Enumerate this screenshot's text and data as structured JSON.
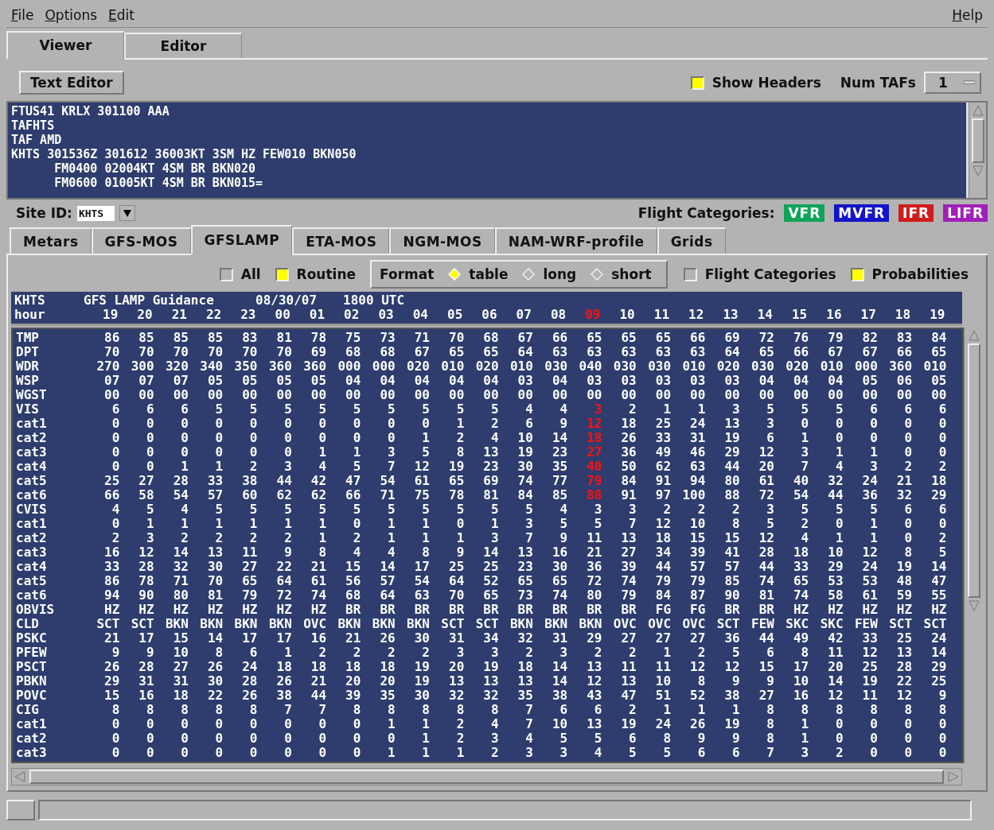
{
  "menu": {
    "left": [
      "File",
      "Options",
      "Edit"
    ],
    "right": [
      "Help"
    ]
  },
  "view_tabs": [
    {
      "label": "Viewer",
      "selected": true
    },
    {
      "label": "Editor",
      "selected": false
    }
  ],
  "toolbar": {
    "text_editor_button": "Text Editor",
    "show_headers": {
      "label": "Show Headers",
      "checked": true
    },
    "num_tafs": {
      "label": "Num TAFs",
      "value": "1"
    }
  },
  "taf_text": [
    "FTUS41 KRLX 301100 AAA",
    "TAFHTS",
    "TAF AMD",
    "KHTS 301536Z 301612 36003KT 3SM HZ FEW010 BKN050",
    "      FM0400 02004KT 4SM BR BKN020",
    "      FM0600 01005KT 4SM BR BKN015="
  ],
  "site": {
    "label": "Site ID:",
    "value": "KHTS"
  },
  "flight_categories": {
    "label": "Flight Categories:",
    "items": [
      {
        "label": "VFR",
        "color": "#0fa45a"
      },
      {
        "label": "MVFR",
        "color": "#1414c8"
      },
      {
        "label": "IFR",
        "color": "#d01c1c"
      },
      {
        "label": "LIFR",
        "color": "#a020b8"
      }
    ]
  },
  "guidance_tabs": [
    {
      "label": "Metars",
      "selected": false
    },
    {
      "label": "GFS-MOS",
      "selected": false
    },
    {
      "label": "GFSLAMP",
      "selected": true
    },
    {
      "label": "ETA-MOS",
      "selected": false
    },
    {
      "label": "NGM-MOS",
      "selected": false
    },
    {
      "label": "NAM-WRF-profile",
      "selected": false
    },
    {
      "label": "Grids",
      "selected": false
    }
  ],
  "options": {
    "all": {
      "label": "All",
      "checked": false
    },
    "routine": {
      "label": "Routine",
      "checked": true
    },
    "format": {
      "label": "Format",
      "choices": [
        {
          "label": "table",
          "selected": true
        },
        {
          "label": "long",
          "selected": false
        },
        {
          "label": "short",
          "selected": false
        }
      ]
    },
    "flight_categories": {
      "label": "Flight Categories",
      "checked": false
    },
    "probabilities": {
      "label": "Probabilities",
      "checked": true
    }
  },
  "table": {
    "header": {
      "station": "KHTS",
      "title": "GFS LAMP Guidance",
      "date": "08/30/07",
      "time": "1800 UTC"
    },
    "hour_label": "hour",
    "hours": [
      {
        "label": "19",
        "highlighted": false
      },
      {
        "label": "20",
        "highlighted": false
      },
      {
        "label": "21",
        "highlighted": false
      },
      {
        "label": "22",
        "highlighted": false
      },
      {
        "label": "23",
        "highlighted": false
      },
      {
        "label": "00",
        "highlighted": false
      },
      {
        "label": "01",
        "highlighted": false
      },
      {
        "label": "02",
        "highlighted": false
      },
      {
        "label": "03",
        "highlighted": false
      },
      {
        "label": "04",
        "highlighted": false
      },
      {
        "label": "05",
        "highlighted": false
      },
      {
        "label": "06",
        "highlighted": false
      },
      {
        "label": "07",
        "highlighted": false
      },
      {
        "label": "08",
        "highlighted": false
      },
      {
        "label": "09",
        "highlighted": true
      },
      {
        "label": "10",
        "highlighted": false
      },
      {
        "label": "11",
        "highlighted": false
      },
      {
        "label": "12",
        "highlighted": false
      },
      {
        "label": "13",
        "highlighted": false
      },
      {
        "label": "14",
        "highlighted": false
      },
      {
        "label": "15",
        "highlighted": false
      },
      {
        "label": "16",
        "highlighted": false
      },
      {
        "label": "17",
        "highlighted": false
      },
      {
        "label": "18",
        "highlighted": false
      },
      {
        "label": "19",
        "highlighted": false
      }
    ],
    "rows": [
      {
        "label": "TMP",
        "highlighted": false,
        "values": [
          "86",
          "85",
          "85",
          "85",
          "83",
          "81",
          "78",
          "75",
          "73",
          "71",
          "70",
          "68",
          "67",
          "66",
          "65",
          "65",
          "65",
          "66",
          "69",
          "72",
          "76",
          "79",
          "82",
          "83",
          "84"
        ]
      },
      {
        "label": "DPT",
        "highlighted": false,
        "values": [
          "70",
          "70",
          "70",
          "70",
          "70",
          "70",
          "69",
          "68",
          "68",
          "67",
          "65",
          "65",
          "64",
          "63",
          "63",
          "63",
          "63",
          "63",
          "64",
          "65",
          "66",
          "67",
          "67",
          "66",
          "65"
        ]
      },
      {
        "label": "WDR",
        "highlighted": false,
        "values": [
          "270",
          "300",
          "320",
          "340",
          "350",
          "360",
          "360",
          "000",
          "000",
          "020",
          "010",
          "020",
          "010",
          "030",
          "040",
          "030",
          "030",
          "010",
          "020",
          "030",
          "020",
          "010",
          "000",
          "360",
          "010"
        ]
      },
      {
        "label": "WSP",
        "highlighted": false,
        "values": [
          "07",
          "07",
          "07",
          "05",
          "05",
          "05",
          "05",
          "04",
          "04",
          "04",
          "04",
          "04",
          "03",
          "04",
          "03",
          "03",
          "03",
          "03",
          "03",
          "04",
          "04",
          "04",
          "05",
          "06",
          "05"
        ]
      },
      {
        "label": "WGST",
        "highlighted": false,
        "values": [
          "00",
          "00",
          "00",
          "00",
          "00",
          "00",
          "00",
          "00",
          "00",
          "00",
          "00",
          "00",
          "00",
          "00",
          "00",
          "00",
          "00",
          "00",
          "00",
          "00",
          "00",
          "00",
          "00",
          "00",
          "00"
        ]
      },
      {
        "label": "VIS",
        "highlighted": true,
        "values": [
          "6",
          "6",
          "6",
          "5",
          "5",
          "5",
          "5",
          "5",
          "5",
          "5",
          "5",
          "5",
          "4",
          "4",
          "3",
          "2",
          "1",
          "1",
          "3",
          "5",
          "5",
          "5",
          "6",
          "6",
          "6"
        ]
      },
      {
        "label": "cat1",
        "highlighted": true,
        "values": [
          "0",
          "0",
          "0",
          "0",
          "0",
          "0",
          "0",
          "0",
          "0",
          "0",
          "1",
          "2",
          "6",
          "9",
          "12",
          "18",
          "25",
          "24",
          "13",
          "3",
          "0",
          "0",
          "0",
          "0",
          "0"
        ]
      },
      {
        "label": "cat2",
        "highlighted": true,
        "values": [
          "0",
          "0",
          "0",
          "0",
          "0",
          "0",
          "0",
          "0",
          "0",
          "1",
          "2",
          "4",
          "10",
          "14",
          "18",
          "26",
          "33",
          "31",
          "19",
          "6",
          "1",
          "0",
          "0",
          "0",
          "0"
        ]
      },
      {
        "label": "cat3",
        "highlighted": true,
        "values": [
          "0",
          "0",
          "0",
          "0",
          "0",
          "0",
          "1",
          "1",
          "3",
          "5",
          "8",
          "13",
          "19",
          "23",
          "27",
          "36",
          "49",
          "46",
          "29",
          "12",
          "3",
          "1",
          "1",
          "0",
          "0"
        ]
      },
      {
        "label": "cat4",
        "highlighted": true,
        "values": [
          "0",
          "0",
          "1",
          "1",
          "2",
          "3",
          "4",
          "5",
          "7",
          "12",
          "19",
          "23",
          "30",
          "35",
          "40",
          "50",
          "62",
          "63",
          "44",
          "20",
          "7",
          "4",
          "3",
          "2",
          "2"
        ]
      },
      {
        "label": "cat5",
        "highlighted": true,
        "values": [
          "25",
          "27",
          "28",
          "33",
          "38",
          "44",
          "42",
          "47",
          "54",
          "61",
          "65",
          "69",
          "74",
          "77",
          "79",
          "84",
          "91",
          "94",
          "80",
          "61",
          "40",
          "32",
          "24",
          "21",
          "18"
        ]
      },
      {
        "label": "cat6",
        "highlighted": true,
        "values": [
          "66",
          "58",
          "54",
          "57",
          "60",
          "62",
          "62",
          "66",
          "71",
          "75",
          "78",
          "81",
          "84",
          "85",
          "88",
          "91",
          "97",
          "100",
          "88",
          "72",
          "54",
          "44",
          "36",
          "32",
          "29"
        ]
      },
      {
        "label": "CVIS",
        "highlighted": false,
        "values": [
          "4",
          "5",
          "4",
          "5",
          "5",
          "5",
          "5",
          "5",
          "5",
          "5",
          "5",
          "5",
          "5",
          "4",
          "3",
          "3",
          "2",
          "2",
          "2",
          "3",
          "5",
          "5",
          "5",
          "6",
          "6"
        ]
      },
      {
        "label": "cat1",
        "highlighted": false,
        "values": [
          "0",
          "1",
          "1",
          "1",
          "1",
          "1",
          "1",
          "0",
          "1",
          "1",
          "0",
          "1",
          "3",
          "5",
          "5",
          "7",
          "12",
          "10",
          "8",
          "5",
          "2",
          "0",
          "1",
          "0",
          "0"
        ]
      },
      {
        "label": "cat2",
        "highlighted": false,
        "values": [
          "2",
          "3",
          "2",
          "2",
          "2",
          "2",
          "1",
          "2",
          "1",
          "1",
          "1",
          "3",
          "7",
          "9",
          "11",
          "13",
          "18",
          "15",
          "15",
          "12",
          "4",
          "1",
          "1",
          "0",
          "2"
        ]
      },
      {
        "label": "cat3",
        "highlighted": false,
        "values": [
          "16",
          "12",
          "14",
          "13",
          "11",
          "9",
          "8",
          "4",
          "4",
          "8",
          "9",
          "14",
          "13",
          "16",
          "21",
          "27",
          "34",
          "39",
          "41",
          "28",
          "18",
          "10",
          "12",
          "8",
          "5"
        ]
      },
      {
        "label": "cat4",
        "highlighted": false,
        "values": [
          "33",
          "28",
          "32",
          "30",
          "27",
          "22",
          "21",
          "15",
          "14",
          "17",
          "25",
          "25",
          "23",
          "30",
          "36",
          "39",
          "44",
          "57",
          "57",
          "44",
          "33",
          "29",
          "24",
          "19",
          "14"
        ]
      },
      {
        "label": "cat5",
        "highlighted": false,
        "values": [
          "86",
          "78",
          "71",
          "70",
          "65",
          "64",
          "61",
          "56",
          "57",
          "54",
          "64",
          "52",
          "65",
          "65",
          "72",
          "74",
          "79",
          "79",
          "85",
          "74",
          "65",
          "53",
          "53",
          "48",
          "47"
        ]
      },
      {
        "label": "cat6",
        "highlighted": false,
        "values": [
          "94",
          "90",
          "80",
          "81",
          "79",
          "72",
          "74",
          "68",
          "64",
          "63",
          "70",
          "65",
          "73",
          "74",
          "80",
          "79",
          "84",
          "87",
          "90",
          "81",
          "74",
          "58",
          "61",
          "59",
          "55"
        ]
      },
      {
        "label": "OBVIS",
        "highlighted": false,
        "values": [
          "HZ",
          "HZ",
          "HZ",
          "HZ",
          "HZ",
          "HZ",
          "HZ",
          "BR",
          "BR",
          "BR",
          "BR",
          "BR",
          "BR",
          "BR",
          "BR",
          "BR",
          "FG",
          "FG",
          "BR",
          "BR",
          "HZ",
          "HZ",
          "HZ",
          "HZ",
          "HZ"
        ]
      },
      {
        "label": "CLD",
        "highlighted": false,
        "values": [
          "SCT",
          "SCT",
          "BKN",
          "BKN",
          "BKN",
          "BKN",
          "OVC",
          "BKN",
          "BKN",
          "BKN",
          "SCT",
          "SCT",
          "BKN",
          "BKN",
          "BKN",
          "OVC",
          "OVC",
          "OVC",
          "SCT",
          "FEW",
          "SKC",
          "SKC",
          "FEW",
          "SCT",
          "SCT"
        ]
      },
      {
        "label": "PSKC",
        "highlighted": false,
        "values": [
          "21",
          "17",
          "15",
          "14",
          "17",
          "17",
          "16",
          "21",
          "26",
          "30",
          "31",
          "34",
          "32",
          "31",
          "29",
          "27",
          "27",
          "27",
          "36",
          "44",
          "49",
          "42",
          "33",
          "25",
          "24"
        ]
      },
      {
        "label": "PFEW",
        "highlighted": false,
        "values": [
          "9",
          "9",
          "10",
          "8",
          "6",
          "1",
          "2",
          "2",
          "2",
          "2",
          "3",
          "3",
          "2",
          "3",
          "2",
          "2",
          "1",
          "2",
          "5",
          "6",
          "8",
          "11",
          "12",
          "13",
          "14"
        ]
      },
      {
        "label": "PSCT",
        "highlighted": false,
        "values": [
          "26",
          "28",
          "27",
          "26",
          "24",
          "18",
          "18",
          "18",
          "18",
          "19",
          "20",
          "19",
          "18",
          "14",
          "13",
          "11",
          "11",
          "12",
          "12",
          "15",
          "17",
          "20",
          "25",
          "28",
          "29"
        ]
      },
      {
        "label": "PBKN",
        "highlighted": false,
        "values": [
          "29",
          "31",
          "31",
          "30",
          "28",
          "26",
          "21",
          "20",
          "20",
          "19",
          "13",
          "13",
          "13",
          "14",
          "12",
          "13",
          "10",
          "8",
          "9",
          "9",
          "10",
          "14",
          "19",
          "22",
          "25"
        ]
      },
      {
        "label": "POVC",
        "highlighted": false,
        "values": [
          "15",
          "16",
          "18",
          "22",
          "26",
          "38",
          "44",
          "39",
          "35",
          "30",
          "32",
          "32",
          "35",
          "38",
          "43",
          "47",
          "51",
          "52",
          "38",
          "27",
          "16",
          "12",
          "11",
          "12",
          "9"
        ]
      },
      {
        "label": "CIG",
        "highlighted": false,
        "values": [
          "8",
          "8",
          "8",
          "8",
          "8",
          "7",
          "7",
          "8",
          "8",
          "8",
          "8",
          "8",
          "7",
          "6",
          "6",
          "2",
          "1",
          "1",
          "1",
          "8",
          "8",
          "8",
          "8",
          "8",
          "8"
        ]
      },
      {
        "label": "cat1",
        "highlighted": false,
        "values": [
          "0",
          "0",
          "0",
          "0",
          "0",
          "0",
          "0",
          "0",
          "1",
          "1",
          "2",
          "4",
          "7",
          "10",
          "13",
          "19",
          "24",
          "26",
          "19",
          "8",
          "1",
          "0",
          "0",
          "0",
          "0"
        ]
      },
      {
        "label": "cat2",
        "highlighted": false,
        "values": [
          "0",
          "0",
          "0",
          "0",
          "0",
          "0",
          "0",
          "0",
          "0",
          "1",
          "2",
          "3",
          "4",
          "5",
          "5",
          "6",
          "8",
          "9",
          "9",
          "8",
          "1",
          "0",
          "0",
          "0",
          "0"
        ]
      },
      {
        "label": "cat3",
        "highlighted": false,
        "values": [
          "0",
          "0",
          "0",
          "0",
          "0",
          "0",
          "0",
          "0",
          "1",
          "1",
          "1",
          "2",
          "3",
          "3",
          "4",
          "5",
          "5",
          "6",
          "6",
          "7",
          "3",
          "2",
          "0",
          "0",
          "0"
        ]
      }
    ]
  }
}
